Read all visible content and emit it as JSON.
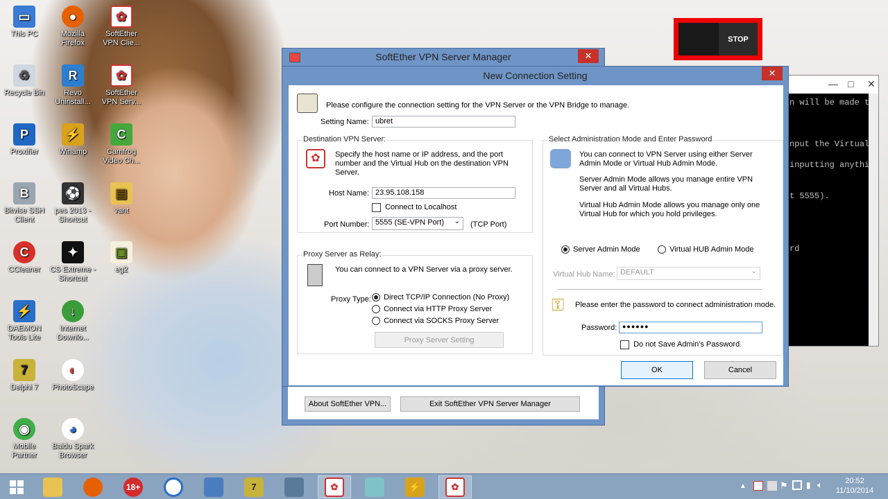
{
  "desktop": {
    "icons": [
      {
        "label": "This PC",
        "icon": "computer-icon"
      },
      {
        "label": "Mozilla Firefox",
        "icon": "firefox-icon"
      },
      {
        "label": "SoftEther VPN Clie...",
        "icon": "softether-icon"
      },
      {
        "label": "Recycle Bin",
        "icon": "recycle-bin-icon"
      },
      {
        "label": "Revo Uninstall...",
        "icon": "revo-icon"
      },
      {
        "label": "SoftEther VPN Serv...",
        "icon": "softether-icon"
      },
      {
        "label": "Proxifier",
        "icon": "proxifier-icon"
      },
      {
        "label": "Winamp",
        "icon": "winamp-icon"
      },
      {
        "label": "Camfrog Video Ch...",
        "icon": "camfrog-icon"
      },
      {
        "label": "Bitvise SSH Client",
        "icon": "bitvise-icon"
      },
      {
        "label": "pes 2013 - Shortcut",
        "icon": "pes-icon"
      },
      {
        "label": "vant",
        "icon": "folder-icon"
      },
      {
        "label": "CCleaner",
        "icon": "ccleaner-icon"
      },
      {
        "label": "CS Extreme - Shortcut",
        "icon": "cs-icon"
      },
      {
        "label": "eg2",
        "icon": "file-icon"
      },
      {
        "label": "DAEMON Tools Lite",
        "icon": "daemon-icon"
      },
      {
        "label": "Internet Downlo...",
        "icon": "idm-icon"
      },
      {
        "label": "Delphi 7",
        "icon": "delphi-icon"
      },
      {
        "label": "PhotoScape",
        "icon": "photoscape-icon"
      },
      {
        "label": "Mobile Partner",
        "icon": "mobile-partner-icon"
      },
      {
        "label": "Baidu Spark Browser",
        "icon": "baidu-icon"
      }
    ]
  },
  "stop_overlay": {
    "label": "STOP"
  },
  "terminal": {
    "lines": [
      "n will be made to",
      "",
      "nput the Virtual",
      "",
      "inputting anythin",
      "",
      "t 5555).",
      "",
      "",
      "rd"
    ]
  },
  "manager": {
    "title": "SoftEther VPN Server Manager",
    "about_button": "About SoftEther VPN...",
    "exit_button": "Exit SoftEther VPN Server Manager"
  },
  "dialog": {
    "title": "New Connection Setting",
    "intro": "Please configure the connection setting for the VPN Server or the VPN Bridge to manage.",
    "setting_name_label": "Setting Name:",
    "setting_name_value": "ubret",
    "destination": {
      "group_label": "Destination VPN Server:",
      "desc": "Specify the host name or IP address, and the port number and the Virtual Hub on the destination VPN Server.",
      "host_label": "Host Name:",
      "host_value": "23.95.108.158",
      "localhost_label": "Connect to Localhost",
      "port_label": "Port Number:",
      "port_value": "5555 (SE-VPN Port)",
      "port_unit": "(TCP Port)"
    },
    "proxy": {
      "group_label": "Proxy Server as Relay:",
      "desc": "You can connect to a VPN Server via a proxy server.",
      "type_label": "Proxy Type:",
      "options": [
        "Direct TCP/IP Connection (No Proxy)",
        "Connect via HTTP Proxy Server",
        "Connect via SOCKS Proxy Server"
      ],
      "selected": 0,
      "setting_button": "Proxy Server Setting"
    },
    "admin": {
      "group_label": "Select Administration Mode and Enter Password",
      "desc1": "You can connect to VPN Server using either Server Admin Mode or Virtual Hub Admin Mode.",
      "desc2": "Server Admin Mode allows you manage entire VPN Server and all Virtual Hubs.",
      "desc3": "Virtual Hub Admin Mode allows you manage only one Virtual Hub for which you hold privileges.",
      "mode_server": "Server Admin Mode",
      "mode_hub": "Virtual HUB Admin Mode",
      "hub_name_label": "Virtual Hub Name:",
      "hub_name_value": "DEFAULT",
      "password_prompt": "Please enter the password to connect administration mode.",
      "password_label": "Password:",
      "password_value": "●●●●●●",
      "no_save_label": "Do not Save Admin's Password"
    },
    "ok_button": "OK",
    "cancel_button": "Cancel"
  },
  "taskbar": {
    "badge_18": "18+",
    "clock_time": "20:52",
    "clock_date": "11/10/2014"
  }
}
